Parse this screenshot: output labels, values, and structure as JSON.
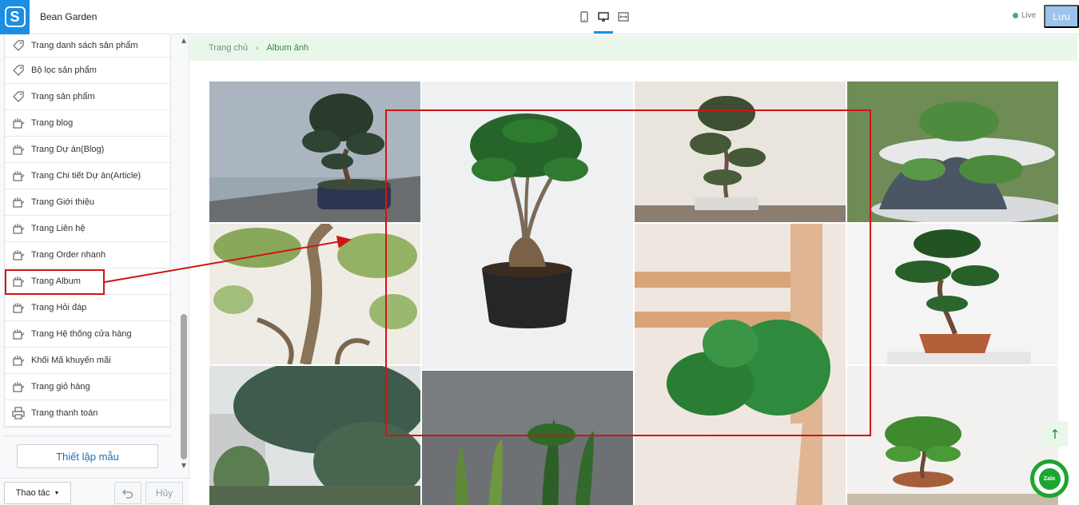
{
  "store": {
    "name": "Bean Garden"
  },
  "sidebar": {
    "items": [
      {
        "label": "Trang danh sách sản phẩm",
        "icon": "tag-icon"
      },
      {
        "label": "Bộ lọc sản phẩm",
        "icon": "tag-icon"
      },
      {
        "label": "Trang sản phẩm",
        "icon": "tag-icon"
      },
      {
        "label": "Trang blog",
        "icon": "pages-icon"
      },
      {
        "label": "Trang Dự án(Blog)",
        "icon": "pages-icon"
      },
      {
        "label": "Trang Chi tiết Dự án(Article)",
        "icon": "pages-icon"
      },
      {
        "label": "Trang Giới thiệu",
        "icon": "pages-icon"
      },
      {
        "label": "Trang Liên hệ",
        "icon": "pages-icon"
      },
      {
        "label": "Trang Order nhanh",
        "icon": "pages-icon"
      },
      {
        "label": "Trang Album",
        "icon": "pages-icon"
      },
      {
        "label": "Trang Hỏi đáp",
        "icon": "pages-icon"
      },
      {
        "label": "Trang Hệ thống cửa hàng",
        "icon": "pages-icon"
      },
      {
        "label": "Khối Mã khuyến mãi",
        "icon": "pages-icon"
      },
      {
        "label": "Trang giỏ hàng",
        "icon": "pages-icon"
      },
      {
        "label": "Trang thanh toán",
        "icon": "printer-icon"
      }
    ],
    "setup_label": "Thiết lập mẫu"
  },
  "footer": {
    "action_label": "Thao tác",
    "cancel_label": "Hủy"
  },
  "topbar": {
    "live_label": "Live",
    "save_label": "Lưu",
    "active_device": "desktop"
  },
  "breadcrumb": {
    "home": "Trang chủ",
    "current": "Album ảnh"
  },
  "zalo": {
    "label": "Zalo"
  },
  "colors": {
    "accent": "#1a8fe3",
    "annotation": "#d01414",
    "breadcrumb_bg": "#e9f7ea",
    "green": "#2e8b3e"
  }
}
